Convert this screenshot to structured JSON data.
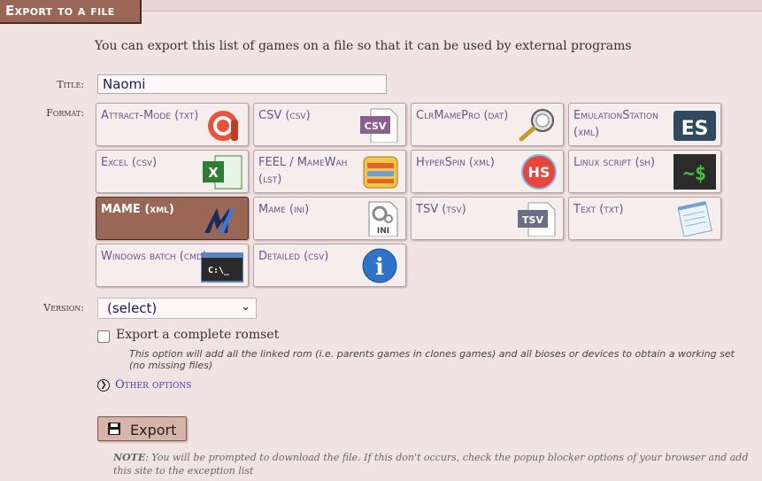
{
  "header": {
    "tab_title": "Export to a file"
  },
  "intro": "You can export this list of games on a file so that it can be used by external programs",
  "title_field": {
    "label": "Title:",
    "value": "Naomi"
  },
  "format": {
    "label": "Format:",
    "selected": "MAME (xml)",
    "options": [
      {
        "label": "Attract-Mode (txt)",
        "icon": "attract-mode-icon"
      },
      {
        "label": "CSV (csv)",
        "icon": "csv-file-icon"
      },
      {
        "label": "ClrMamePro (dat)",
        "icon": "clrmamepro-icon"
      },
      {
        "label": "EmulationStation (xml)",
        "icon": "emulationstation-icon"
      },
      {
        "label": "Excel (csv)",
        "icon": "excel-icon"
      },
      {
        "label": "FEEL / MameWah (lst)",
        "icon": "feel-mamewah-icon"
      },
      {
        "label": "HyperSpin (xml)",
        "icon": "hyperspin-icon"
      },
      {
        "label": "Linux script (sh)",
        "icon": "terminal-icon"
      },
      {
        "label": "MAME (xml)",
        "icon": "mame-logo-icon"
      },
      {
        "label": "Mame (ini)",
        "icon": "ini-file-icon"
      },
      {
        "label": "TSV (tsv)",
        "icon": "tsv-file-icon"
      },
      {
        "label": "Text (txt)",
        "icon": "notepad-icon"
      },
      {
        "label": "Windows batch (cmd)",
        "icon": "cmd-prompt-icon"
      },
      {
        "label": "Detailed (csv)",
        "icon": "info-icon"
      }
    ],
    "icon_text": {
      "csv": "CSV",
      "hs": "HS",
      "sh": "~$",
      "ini": "INI",
      "tsv": "TSV",
      "cmd": "C:\\_",
      "info": "i",
      "es": "ES",
      "excel": "X"
    }
  },
  "version": {
    "label": "Version:",
    "value": "(select)"
  },
  "complete_romset": {
    "label": "Export a complete romset",
    "checked": false,
    "help": "This option will add all the linked rom (i.e. parents games in clones games) and all bioses or devices to obtain a working set (no missing files)"
  },
  "other_options": {
    "label": "Other options"
  },
  "export_button": {
    "label": "Export"
  },
  "note": {
    "prefix": "NOTE",
    "text": ": You will be prompted to download the file. If this don't occurs, check the popup blocker options of your browser and add this site to the exception list"
  },
  "colors": {
    "selected": "#9a6655",
    "link": "#4b3fb0",
    "card_text": "#6b5390"
  }
}
